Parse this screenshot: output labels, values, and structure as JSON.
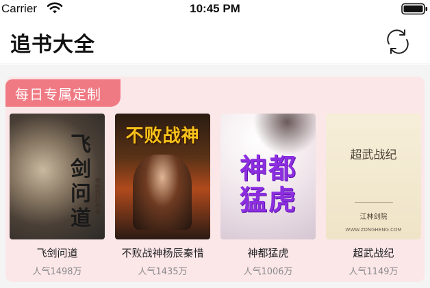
{
  "status": {
    "carrier": "Carrier",
    "time": "10:45 PM"
  },
  "nav": {
    "title": "追书大全"
  },
  "section": {
    "title": "每日专属定制"
  },
  "books": [
    {
      "title": "飞剑问道",
      "popularity": "人气1498万",
      "cover_text": "飞剑问道",
      "cover_author": "我吃西红柿著"
    },
    {
      "title": "不败战神杨辰秦惜",
      "popularity": "人气1435万",
      "cover_text": "不败战神"
    },
    {
      "title": "神都猛虎",
      "popularity": "人气1006万",
      "cover_text": "神都猛虎"
    },
    {
      "title": "超武战纪",
      "popularity": "人气1149万",
      "cover_text": "超武战纪",
      "cover_author": "江林剑院",
      "cover_url": "WWW.ZONGHENG.COM"
    }
  ],
  "colors": {
    "accent": "#f07a84",
    "card_bg": "#fbe6e8"
  }
}
